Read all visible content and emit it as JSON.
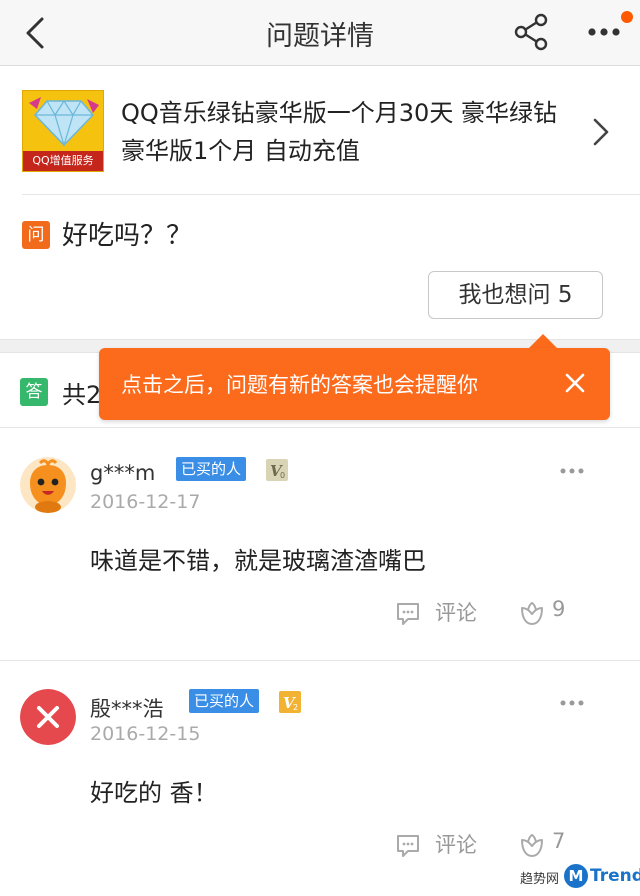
{
  "navbar": {
    "title": "问题详情"
  },
  "product": {
    "title": "QQ音乐绿钻豪华版一个月30天 豪华绿钻豪华版1个月 自动充值",
    "thumb_banner": "QQ增值服务"
  },
  "question": {
    "badge": "问",
    "text": "好吃吗？？",
    "ask_label": "我也想问",
    "ask_count": "5"
  },
  "answers_header": {
    "badge": "答",
    "count_text": "共2"
  },
  "tooltip": {
    "text": "点击之后，问题有新的答案也会提醒你"
  },
  "answers": [
    {
      "user": "g***m",
      "tag": "已买的人",
      "level": "V0",
      "date": "2016-12-17",
      "text": "味道是不错，就是玻璃渣渣嘴巴",
      "comment_label": "评论",
      "likes": "9"
    },
    {
      "user": "殷***浩",
      "tag": "已买的人",
      "level": "V2",
      "date": "2016-12-15",
      "text": "好吃的 香！",
      "comment_label": "评论",
      "likes": "7"
    }
  ],
  "watermark": {
    "prefix": "趋势网",
    "m": "M",
    "brand": "Trend"
  },
  "colors": {
    "accent_orange": "#fc6a1c",
    "question_badge": "#f26b1d",
    "answer_badge": "#35b86b",
    "bought_tag": "#3a8ee6",
    "notification_dot": "#ff5a00"
  }
}
